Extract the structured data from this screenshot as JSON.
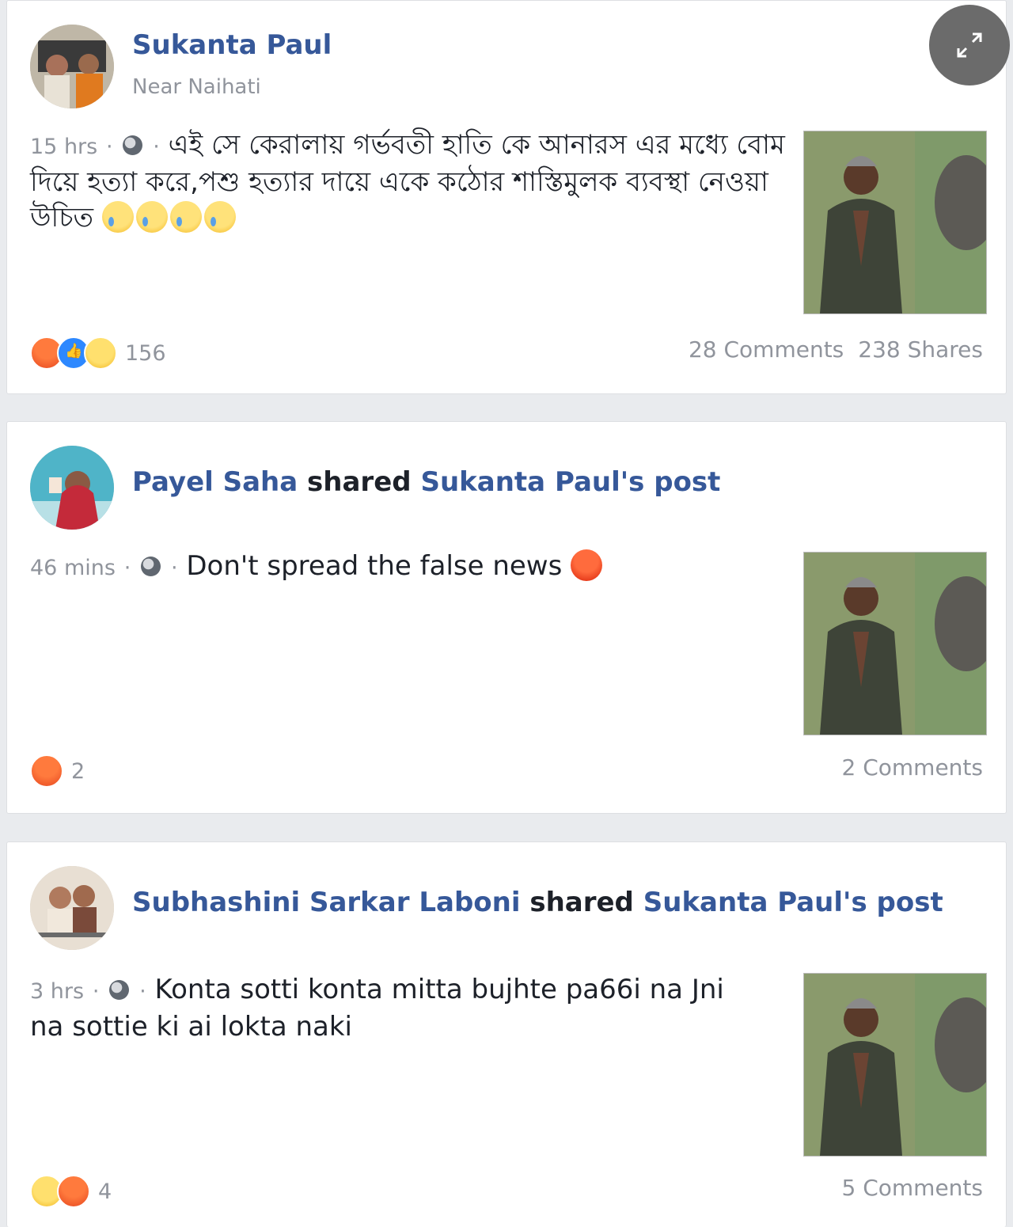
{
  "posts": [
    {
      "author": "Sukanta Paul",
      "location": "Near Naihati",
      "time": "15 hrs",
      "text": "এই সে কেরালায় গর্ভবতী হাতি কে আনারস এর মধ্যে বোম দিয়ে হত্যা করে,পশু হত্যার দায়ে একে কঠোর শাস্তিমুলক ব্যবস্থা নেওয়া উচিত",
      "text_emojis": [
        "crying",
        "crying",
        "crying",
        "crying"
      ],
      "reaction_icons": [
        "angry",
        "like",
        "sad"
      ],
      "reaction_count": "156",
      "comments": "28 Comments",
      "shares": "238 Shares"
    },
    {
      "sharer": "Payel Saha",
      "verb": "shared",
      "original": "Sukanta Paul's post",
      "time": "46 mins",
      "text": "Don't spread the false news",
      "text_emojis": [
        "pouting"
      ],
      "reaction_icons": [
        "angry"
      ],
      "reaction_count": "2",
      "comments": "2 Comments"
    },
    {
      "sharer": "Subhashini Sarkar Laboni",
      "verb": "shared",
      "original": "Sukanta Paul's post",
      "time": "3 hrs",
      "text": "Konta sotti konta mitta bujhte pa66i na Jni na sottie ki ai lokta naki",
      "reaction_icons": [
        "sad",
        "angry"
      ],
      "reaction_count": "4",
      "comments": "5 Comments"
    }
  ],
  "separator": "·",
  "icons": {
    "expand": "expand-icon",
    "privacy": "globe-icon"
  }
}
